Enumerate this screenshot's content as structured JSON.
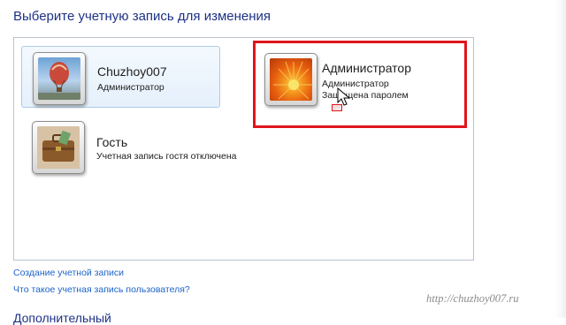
{
  "header": {
    "title": "Выберите учетную запись для изменения"
  },
  "accounts": [
    {
      "name": "Chuzhoy007",
      "lines": [
        "Администратор"
      ],
      "picture": "hot-air-balloon-icon"
    },
    {
      "name": "Администратор",
      "lines": [
        "Администратор",
        "Защищена паролем"
      ],
      "picture": "orange-flower-icon"
    },
    {
      "name": "Гость",
      "lines": [
        "Учетная запись гостя отключена"
      ],
      "picture": "briefcase-icon"
    }
  ],
  "links": {
    "create_account": "Создание учетной записи",
    "what_is_account": "Что такое учетная запись пользователя?"
  },
  "footer": {
    "cut_heading": "Дополнительный"
  },
  "watermark": "http://chuzhoy007.ru",
  "colors": {
    "title": "#1e3287",
    "link": "#1e64c8",
    "highlight": "#e0151b",
    "selected_bg": "#e5f0fb"
  }
}
